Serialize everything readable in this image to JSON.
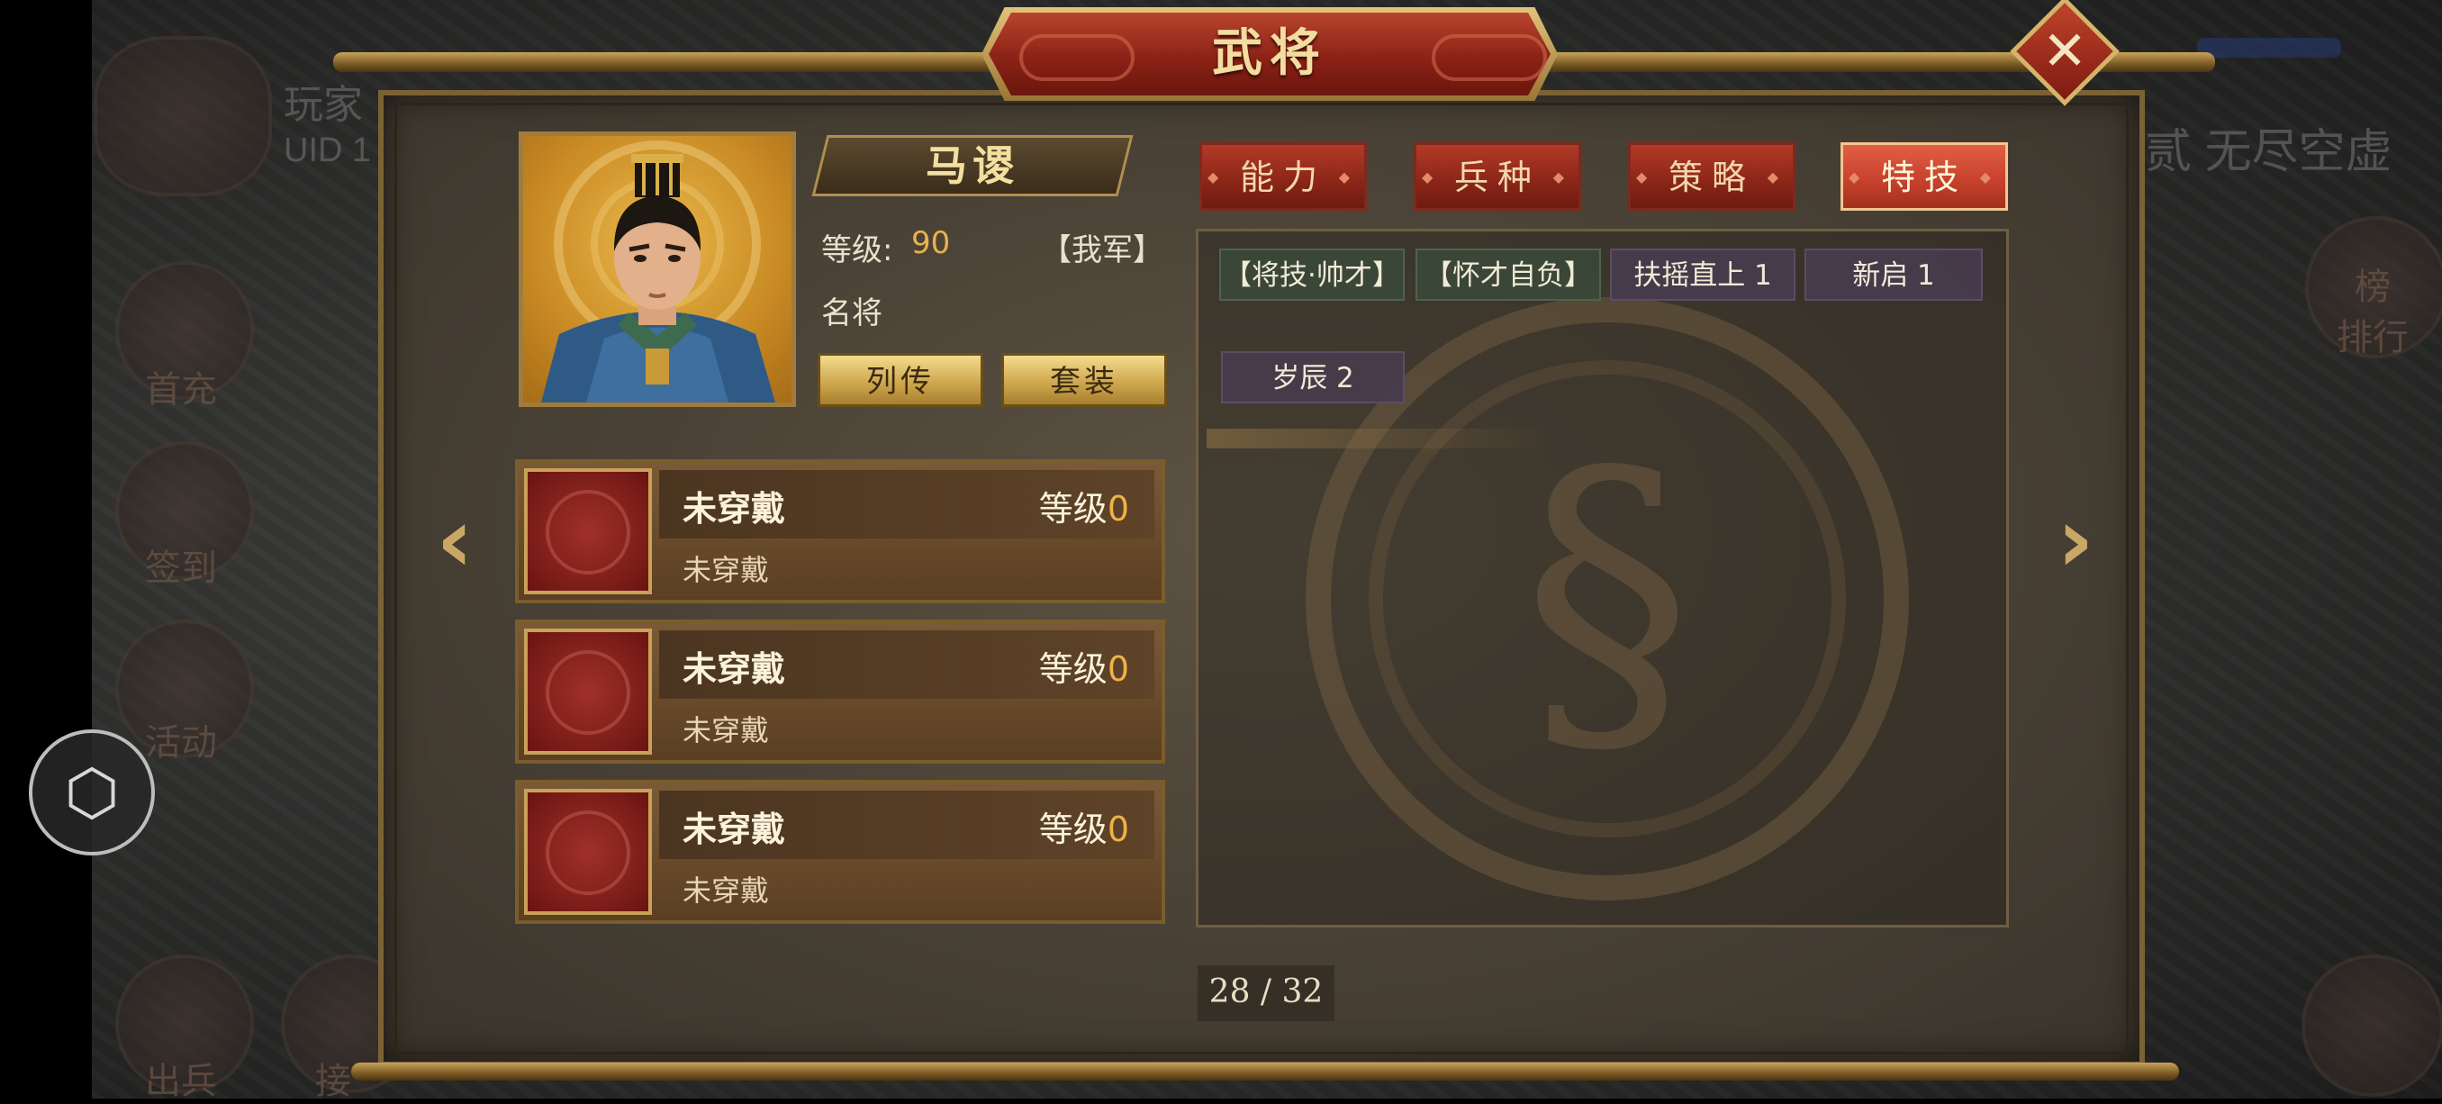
{
  "dialog": {
    "title": "武将",
    "close_icon": "close-icon"
  },
  "hero": {
    "name": "马谡",
    "level_label": "等级:",
    "level_value": "90",
    "faction": "【我军】",
    "rank": "名将",
    "biography_button": "列传",
    "set_button": "套装"
  },
  "tabs": [
    {
      "label": "能力",
      "active": false
    },
    {
      "label": "兵种",
      "active": false
    },
    {
      "label": "策略",
      "active": false
    },
    {
      "label": "特技",
      "active": true
    }
  ],
  "skills": [
    {
      "label": "【将技·帅才】",
      "style": "green"
    },
    {
      "label": "【怀才自负】",
      "style": "green"
    },
    {
      "label": "扶摇直上 1",
      "style": "purple"
    },
    {
      "label": "新启 1",
      "style": "purple"
    },
    {
      "label": "岁辰 2",
      "style": "purple"
    }
  ],
  "equipment": [
    {
      "name": "未穿戴",
      "level_label": "等级",
      "level_value": "0",
      "status": "未穿戴"
    },
    {
      "name": "未穿戴",
      "level_label": "等级",
      "level_value": "0",
      "status": "未穿戴"
    },
    {
      "name": "未穿戴",
      "level_label": "等级",
      "level_value": "0",
      "status": "未穿戴"
    }
  ],
  "pagination": {
    "text": "28 / 32",
    "current": 28,
    "total": 32
  },
  "background": {
    "player_label": "玩家",
    "uid_label": "UID 1",
    "server_text": "贰 无尽空虚",
    "side_items": [
      "首充",
      "签到",
      "活动",
      "出兵",
      "接"
    ],
    "rank_label": "排行",
    "rank_icon_text": "榜"
  },
  "colors": {
    "accent_red": "#b23a28",
    "gold": "#e8b34b",
    "panel": "#4a4236"
  }
}
